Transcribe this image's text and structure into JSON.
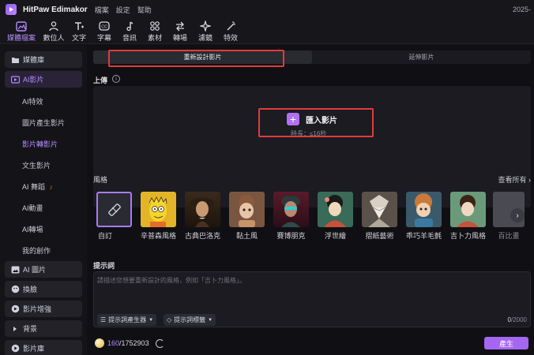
{
  "app": {
    "title": "HitPaw Edimakor",
    "menu": [
      "檔案",
      "設定",
      "幫助"
    ],
    "date": "2025-"
  },
  "toolbar": {
    "items": [
      {
        "label": "媒體檔案",
        "icon": "media-files-icon",
        "active": true
      },
      {
        "label": "數位人",
        "icon": "avatar-person-icon"
      },
      {
        "label": "文字",
        "icon": "text-icon"
      },
      {
        "label": "字幕",
        "icon": "subtitles-icon"
      },
      {
        "label": "音訊",
        "icon": "audio-note-icon"
      },
      {
        "label": "素材",
        "icon": "assets-grid-icon"
      },
      {
        "label": "轉場",
        "icon": "transition-icon"
      },
      {
        "label": "濾鏡",
        "icon": "filter-sparkle-icon"
      },
      {
        "label": "特效",
        "icon": "effects-wand-icon"
      }
    ]
  },
  "sidebar": {
    "groups": [
      {
        "label": "媒體庫",
        "icon": "folder-icon"
      },
      {
        "label": "AI影片",
        "icon": "ai-video-icon",
        "active": true
      },
      {
        "label": "AI 圖片",
        "icon": "ai-image-icon"
      },
      {
        "label": "換臉",
        "icon": "face-swap-icon"
      },
      {
        "label": "影片增強",
        "icon": "enhance-icon"
      },
      {
        "label": "背景",
        "icon": "triangle-right-icon"
      },
      {
        "label": "影片庫",
        "icon": "play-circle-icon"
      }
    ],
    "sub_items": [
      {
        "label": "AI特效"
      },
      {
        "label": "圖片產生影片"
      },
      {
        "label": "影片轉影片",
        "active": true
      },
      {
        "label": "文生影片"
      },
      {
        "label": "AI 舞蹈"
      },
      {
        "label": "AI動畫"
      },
      {
        "label": "AI轉場"
      },
      {
        "label": "我的創作"
      }
    ]
  },
  "main": {
    "tabs": [
      {
        "label": "重新設計影片",
        "active": true
      },
      {
        "label": "延伸影片"
      }
    ],
    "upload_label": "上傳",
    "info": "i",
    "import_label": "匯入影片",
    "import_icon": "+",
    "duration": "時長：≤16秒",
    "styles_label": "風格",
    "view_all": "查看所有 ›",
    "styles": [
      {
        "label": "自訂",
        "custom": true
      },
      {
        "label": "辛普森風格"
      },
      {
        "label": "古典巴洛克"
      },
      {
        "label": "黏土風"
      },
      {
        "label": "賽博朋克"
      },
      {
        "label": "浮世繪"
      },
      {
        "label": "摺紙藝術"
      },
      {
        "label": "乖巧羊毛氈"
      },
      {
        "label": "吉卜力風格"
      },
      {
        "label": "百比畫"
      }
    ],
    "next_icon": "›",
    "prompt_label": "提示詞",
    "prompt_placeholder": "請描述您想要重新設計的風格，例如「吉卜力風格」。",
    "prompt_generator": "提示詞產生器",
    "prompt_tags": "提示詞標籤",
    "char_count": "0",
    "char_limit": "/2000",
    "credits_used": "160",
    "credits_total": "/1752903",
    "generate_label": "產生"
  },
  "colors": {
    "accent": "#b58bff",
    "button": "#a566f2",
    "highlight_box": "#e03c3c"
  }
}
